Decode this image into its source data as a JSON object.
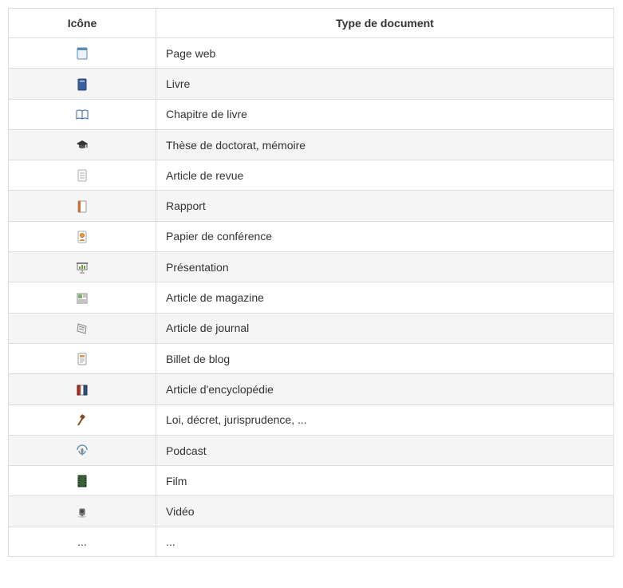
{
  "headers": {
    "icon": "Icône",
    "type": "Type de document"
  },
  "rows": [
    {
      "icon": "webpage",
      "label": "Page web"
    },
    {
      "icon": "book",
      "label": "Livre"
    },
    {
      "icon": "book-open",
      "label": "Chapitre de livre"
    },
    {
      "icon": "graduation-cap",
      "label": "Thèse de doctorat, mémoire"
    },
    {
      "icon": "document",
      "label": "Article de revue"
    },
    {
      "icon": "report",
      "label": "Rapport"
    },
    {
      "icon": "conference",
      "label": "Papier de conférence"
    },
    {
      "icon": "presentation",
      "label": "Présentation"
    },
    {
      "icon": "magazine",
      "label": "Article de magazine"
    },
    {
      "icon": "newspaper",
      "label": "Article de journal"
    },
    {
      "icon": "blog",
      "label": "Billet de blog"
    },
    {
      "icon": "encyclopedia",
      "label": "Article d'encyclopédie"
    },
    {
      "icon": "gavel",
      "label": "Loi, décret, jurisprudence, ..."
    },
    {
      "icon": "podcast",
      "label": "Podcast"
    },
    {
      "icon": "film",
      "label": "Film"
    },
    {
      "icon": "video",
      "label": "Vidéo"
    },
    {
      "icon": "ellipsis",
      "label": "..."
    }
  ]
}
